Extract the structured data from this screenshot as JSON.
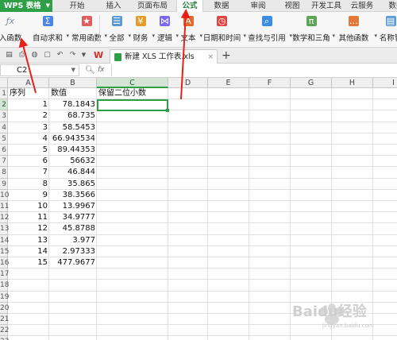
{
  "menubar": {
    "app_button": "WPS 表格",
    "items": [
      {
        "label": "开始"
      },
      {
        "label": "插入"
      },
      {
        "label": "页面布局"
      },
      {
        "label": "公式",
        "active": true
      },
      {
        "label": "数据"
      },
      {
        "label": "审阅"
      },
      {
        "label": "视图"
      },
      {
        "label": "开发工具"
      },
      {
        "label": "云服务"
      },
      {
        "label": "数据"
      }
    ]
  },
  "ribbon": {
    "items": [
      {
        "label": "入函数",
        "icon": "fx-icon"
      },
      {
        "label": "自动求和",
        "icon": "sigma-icon",
        "dropdown": true
      },
      {
        "label": "常用函数",
        "icon": "star-icon",
        "dropdown": true
      },
      {
        "label": "全部",
        "icon": "list-icon",
        "dropdown": true
      },
      {
        "label": "财务",
        "icon": "finance-icon",
        "dropdown": true
      },
      {
        "label": "逻辑",
        "icon": "logic-icon",
        "dropdown": true
      },
      {
        "label": "文本",
        "icon": "text-icon",
        "dropdown": true
      },
      {
        "label": "日期和时间",
        "icon": "clock-icon",
        "dropdown": true
      },
      {
        "label": "查找与引用",
        "icon": "lookup-icon",
        "dropdown": true
      },
      {
        "label": "数学和三角",
        "icon": "math-icon",
        "dropdown": true
      },
      {
        "label": "其他函数",
        "icon": "more-icon",
        "dropdown": true
      },
      {
        "label": "名称管",
        "icon": "name-manager-icon"
      }
    ]
  },
  "tabs": {
    "document": "新建 XLS 工作表.xls"
  },
  "formula_bar": {
    "name_box": "C2",
    "fx": "fx",
    "value": ""
  },
  "sheet": {
    "columns": [
      "A",
      "B",
      "C",
      "D",
      "E",
      "F",
      "G",
      "H",
      "I"
    ],
    "rows": [
      "1",
      "2",
      "3",
      "4",
      "5",
      "6",
      "7",
      "8",
      "9",
      "10",
      "11",
      "12",
      "13",
      "14",
      "15",
      "16",
      "17",
      "18",
      "19",
      "20",
      "21",
      "22",
      "23"
    ],
    "active_cell": "C2",
    "cells": [
      {
        "r": 1,
        "c": "A",
        "v": "序列",
        "num": false
      },
      {
        "r": 1,
        "c": "B",
        "v": "数值",
        "num": false
      },
      {
        "r": 1,
        "c": "C",
        "v": "保留二位小数",
        "num": false
      },
      {
        "r": 2,
        "c": "A",
        "v": "1",
        "num": true
      },
      {
        "r": 2,
        "c": "B",
        "v": "78.1843",
        "num": true
      },
      {
        "r": 3,
        "c": "A",
        "v": "2",
        "num": true
      },
      {
        "r": 3,
        "c": "B",
        "v": "68.735",
        "num": true
      },
      {
        "r": 4,
        "c": "A",
        "v": "3",
        "num": true
      },
      {
        "r": 4,
        "c": "B",
        "v": "58.5453",
        "num": true
      },
      {
        "r": 5,
        "c": "A",
        "v": "4",
        "num": true
      },
      {
        "r": 5,
        "c": "B",
        "v": "66.943534",
        "num": true
      },
      {
        "r": 6,
        "c": "A",
        "v": "5",
        "num": true
      },
      {
        "r": 6,
        "c": "B",
        "v": "89.44353",
        "num": true
      },
      {
        "r": 7,
        "c": "A",
        "v": "6",
        "num": true
      },
      {
        "r": 7,
        "c": "B",
        "v": "56632",
        "num": true
      },
      {
        "r": 8,
        "c": "A",
        "v": "7",
        "num": true
      },
      {
        "r": 8,
        "c": "B",
        "v": "46.844",
        "num": true
      },
      {
        "r": 9,
        "c": "A",
        "v": "8",
        "num": true
      },
      {
        "r": 9,
        "c": "B",
        "v": "35.865",
        "num": true
      },
      {
        "r": 10,
        "c": "A",
        "v": "9",
        "num": true
      },
      {
        "r": 10,
        "c": "B",
        "v": "38.3566",
        "num": true
      },
      {
        "r": 11,
        "c": "A",
        "v": "10",
        "num": true
      },
      {
        "r": 11,
        "c": "B",
        "v": "13.9967",
        "num": true
      },
      {
        "r": 12,
        "c": "A",
        "v": "11",
        "num": true
      },
      {
        "r": 12,
        "c": "B",
        "v": "34.9777",
        "num": true
      },
      {
        "r": 13,
        "c": "A",
        "v": "12",
        "num": true
      },
      {
        "r": 13,
        "c": "B",
        "v": "45.8788",
        "num": true
      },
      {
        "r": 14,
        "c": "A",
        "v": "13",
        "num": true
      },
      {
        "r": 14,
        "c": "B",
        "v": "3.977",
        "num": true
      },
      {
        "r": 15,
        "c": "A",
        "v": "14",
        "num": true
      },
      {
        "r": 15,
        "c": "B",
        "v": "2.97333",
        "num": true
      },
      {
        "r": 16,
        "c": "A",
        "v": "15",
        "num": true
      },
      {
        "r": 16,
        "c": "B",
        "v": "477.9677",
        "num": true
      }
    ]
  },
  "watermark": {
    "text": "Baidu经验",
    "sub": "jingyan.baidu.com"
  },
  "colors": {
    "wps_green": "#2e9e47",
    "arrow_red": "#e8201a"
  }
}
